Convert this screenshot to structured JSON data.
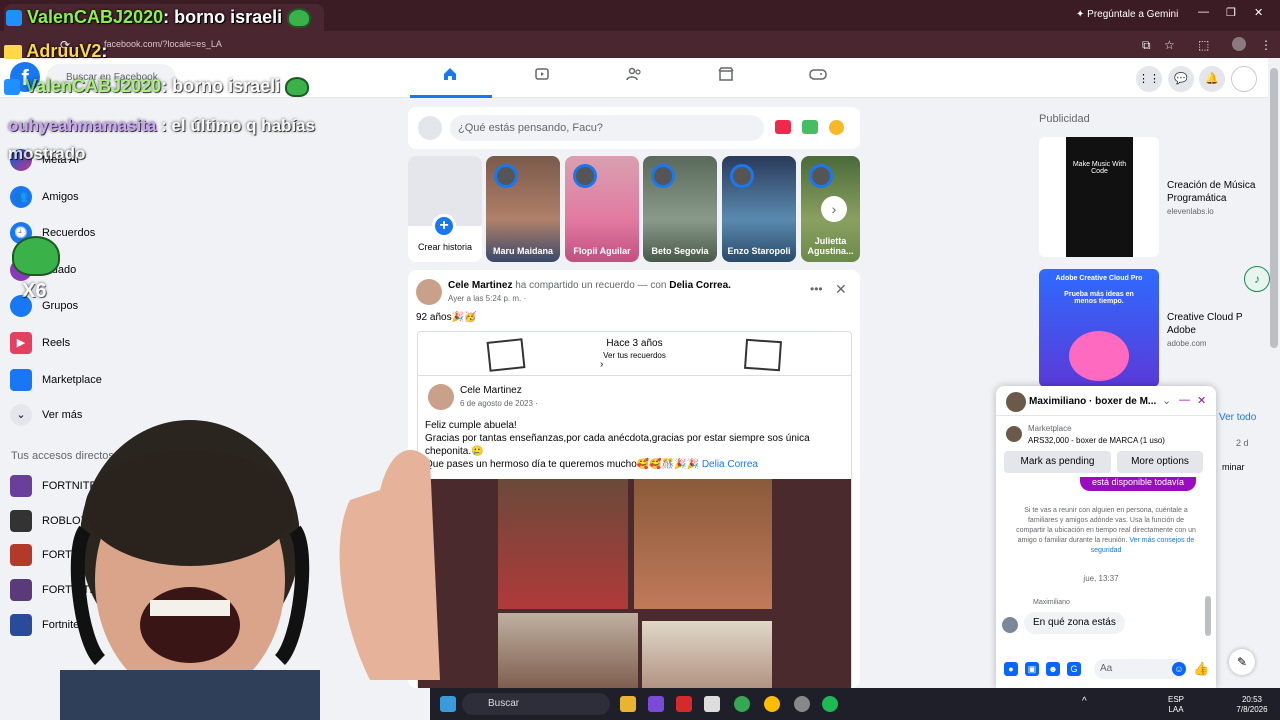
{
  "browser": {
    "url": "facebook.com/?locale=es_LA",
    "gemini_label": "Pregúntale a Gemini"
  },
  "fb": {
    "logo": "f",
    "search_placeholder": "Buscar en Facebook"
  },
  "sidebar": {
    "items": [
      {
        "label": "Meta AI"
      },
      {
        "label": "Amigos"
      },
      {
        "label": "Recuerdos"
      },
      {
        "label": "ardado"
      },
      {
        "label": "Grupos"
      },
      {
        "label": "Reels"
      },
      {
        "label": "Marketplace"
      },
      {
        "label": "Ver más"
      }
    ],
    "shortcuts_heading": "Tus accesos directos",
    "shortcuts": [
      {
        "label": "FORTNITE LATA"
      },
      {
        "label": "ROBLOX LAT"
      },
      {
        "label": "FORTNITE"
      },
      {
        "label": "FORTNITE"
      },
      {
        "label": "Fortnite P"
      }
    ]
  },
  "composer": {
    "placeholder": "¿Qué estás pensando, Facu?"
  },
  "stories": {
    "create_label": "Crear historia",
    "items": [
      {
        "name": "Maru Maidana"
      },
      {
        "name": "Flopii Aguilar"
      },
      {
        "name": "Beto Segovia"
      },
      {
        "name": "Enzo Staropoli"
      },
      {
        "name": "Julietta Agustina..."
      }
    ]
  },
  "post": {
    "author": "Cele Martinez",
    "action": "ha compartido un recuerdo — con",
    "tagged": "Delia Correa.",
    "time": "Ayer a las 5:24 p. m. ·",
    "text": "92 años🎉🥳",
    "memory": {
      "title": "Hace 3 años",
      "subtitle": "Ver tus recuerdos"
    },
    "inner": {
      "author": "Cele Martinez",
      "date": "6 de agosto de 2023 ·",
      "line1": "Feliz cumple abuela!",
      "line2": "Gracias por tantas enseñanzas,por cada anécdota,gracias por estar siempre sos única cheponita.🥲",
      "line3": "Que pases un hermoso día te queremos mucho🥰🥰🎊🎉🎉",
      "tag": "Delia Correa"
    }
  },
  "ads": {
    "title": "Publicidad",
    "items": [
      {
        "name": "Creación de Música Programática",
        "url": "elevenlabs.io",
        "img_text": "Make Music With Code"
      },
      {
        "name": "Creative Cloud P Adobe",
        "url": "adobe.com",
        "img_text": "Adobe Creative Cloud Pro",
        "img_sub": "Prueba más ideas en menos tiempo."
      }
    ],
    "ver_todo": "Ver todo",
    "partial_2d": "2 d",
    "partial_btn": "minar"
  },
  "chat": {
    "name": "Maximiliano · boxer de M...",
    "marketplace_label": "Marketplace",
    "item": "ARS32,000 - boxer de MARCA (1 uso)",
    "btn_pending": "Mark as pending",
    "btn_more": "More options",
    "sent_bubble": "está disponible todavía",
    "safety": "Si te vas a reunir con alguien en persona, cuéntale a familiares y amigos adónde vas. Usa la función de compartir la ubicación en tiempo real directamente con un amigo o familiar durante la reunión.",
    "safety_link": "Ver más consejos de seguridad",
    "time": "jue, 13:37",
    "sender": "Maximiliano",
    "received": "En qué zona estás",
    "input_placeholder": "Aa"
  },
  "overlay": {
    "user1": "ValenCABJ2020",
    "msg1": ": borno israeli",
    "user2": "AdruuV2",
    "msg2": ":",
    "user3": "ValenCABJ2020",
    "msg3": ": borno israeli",
    "user4": "ouhyeahmamasita",
    "msg4": ": el último q habías mostrado",
    "x6": "X6"
  },
  "taskbar": {
    "search": "Buscar",
    "lang1": "ESP",
    "lang2": "LAA",
    "time": "20:53",
    "date": "7/8/2026"
  },
  "colors": {
    "fb_blue": "#1877f2",
    "messenger_purple": "#9b0bbf",
    "tab_bg": "#3b1c25"
  }
}
